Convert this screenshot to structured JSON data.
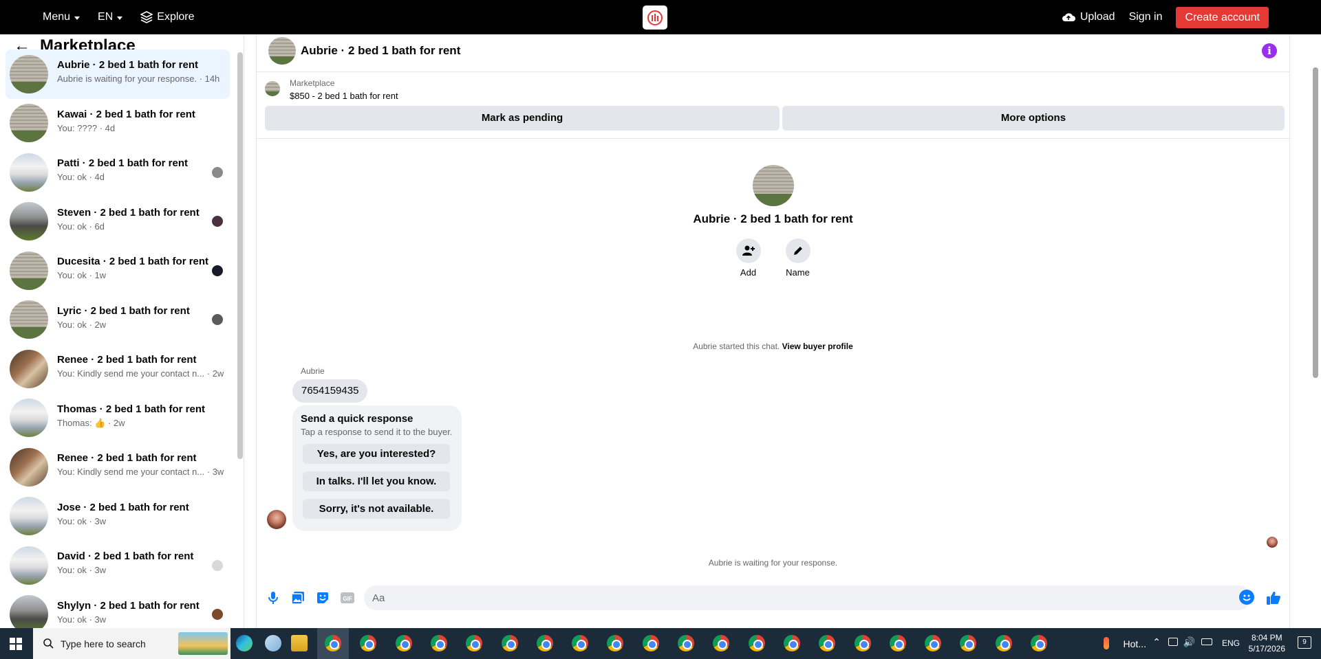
{
  "topbar": {
    "menu_label": "Menu",
    "lang_label": "EN",
    "explore_label": "Explore",
    "upload_label": "Upload",
    "signin_label": "Sign in",
    "create_account_label": "Create account",
    "create_account_color": "#e53935"
  },
  "sidebar": {
    "title": "Marketplace",
    "conversations": [
      {
        "title": "Aubrie · 2 bed 1 bath for rent",
        "sub": "Aubrie is waiting for your response. · 14h",
        "thumb": "house-siding",
        "active": true
      },
      {
        "title": "Kawai · 2 bed 1 bath for rent",
        "sub": "You: ???? · 4d",
        "thumb": "house-siding"
      },
      {
        "title": "Patti · 2 bed 1 bath for rent",
        "sub": "You: ok · 4d",
        "thumb": "house-white"
      },
      {
        "title": "Steven · 2 bed 1 bath for rent",
        "sub": "You: ok · 6d",
        "thumb": "house-dark"
      },
      {
        "title": "Ducesita · 2 bed 1 bath for rent",
        "sub": "You: ok · 1w",
        "thumb": "house-siding"
      },
      {
        "title": "Lyric · 2 bed 1 bath for rent",
        "sub": "You: ok · 2w",
        "thumb": "house-siding"
      },
      {
        "title": "Renee · 2 bed 1 bath for rent",
        "sub": "You: Kindly send me your contact n... · 2w",
        "thumb": "house-interior"
      },
      {
        "title": "Thomas · 2 bed 1 bath for rent",
        "sub": "Thomas: 👍 · 2w",
        "thumb": "house-white"
      },
      {
        "title": "Renee · 2 bed 1 bath for rent",
        "sub": "You: Kindly send me your contact n... · 3w",
        "thumb": "house-interior"
      },
      {
        "title": "Jose · 2 bed 1 bath for rent",
        "sub": "You: ok · 3w",
        "thumb": "house-white"
      },
      {
        "title": "David · 2 bed 1 bath for rent",
        "sub": "You: ok · 3w",
        "thumb": "house-white"
      },
      {
        "title": "Shylyn · 2 bed 1 bath for rent",
        "sub": "You: ok · 3w",
        "thumb": "house-dark"
      }
    ]
  },
  "chat": {
    "header_title": "Aubrie · 2 bed 1 bath for rent",
    "marketplace_label": "Marketplace",
    "listing_price": "$850 - 2 bed 1 bath for rent",
    "mark_pending_label": "Mark as pending",
    "more_options_label": "More options",
    "profile_title": "Aubrie · 2 bed 1 bath for rent",
    "add_label": "Add",
    "name_label": "Name",
    "started_text": "Aubrie started this chat.",
    "view_profile_label": "View buyer profile",
    "sender_name": "Aubrie",
    "message_text": "7654159435",
    "quick_title": "Send a quick response",
    "quick_sub": "Tap a response to send it to the buyer.",
    "quick_responses": [
      "Yes, are you interested?",
      "In talks. I'll let you know.",
      "Sorry, it's not available."
    ],
    "waiting_text": "Aubrie is waiting for your response.",
    "composer_placeholder": "Aa",
    "accent_color": "#0a7cff",
    "info_color": "#9b2ff0"
  },
  "taskbar": {
    "search_placeholder": "Type here to search",
    "weather_label": "Hot...",
    "lang": "ENG",
    "time": "8:04 PM",
    "date": "5/17/2026",
    "notification_count": "9"
  }
}
